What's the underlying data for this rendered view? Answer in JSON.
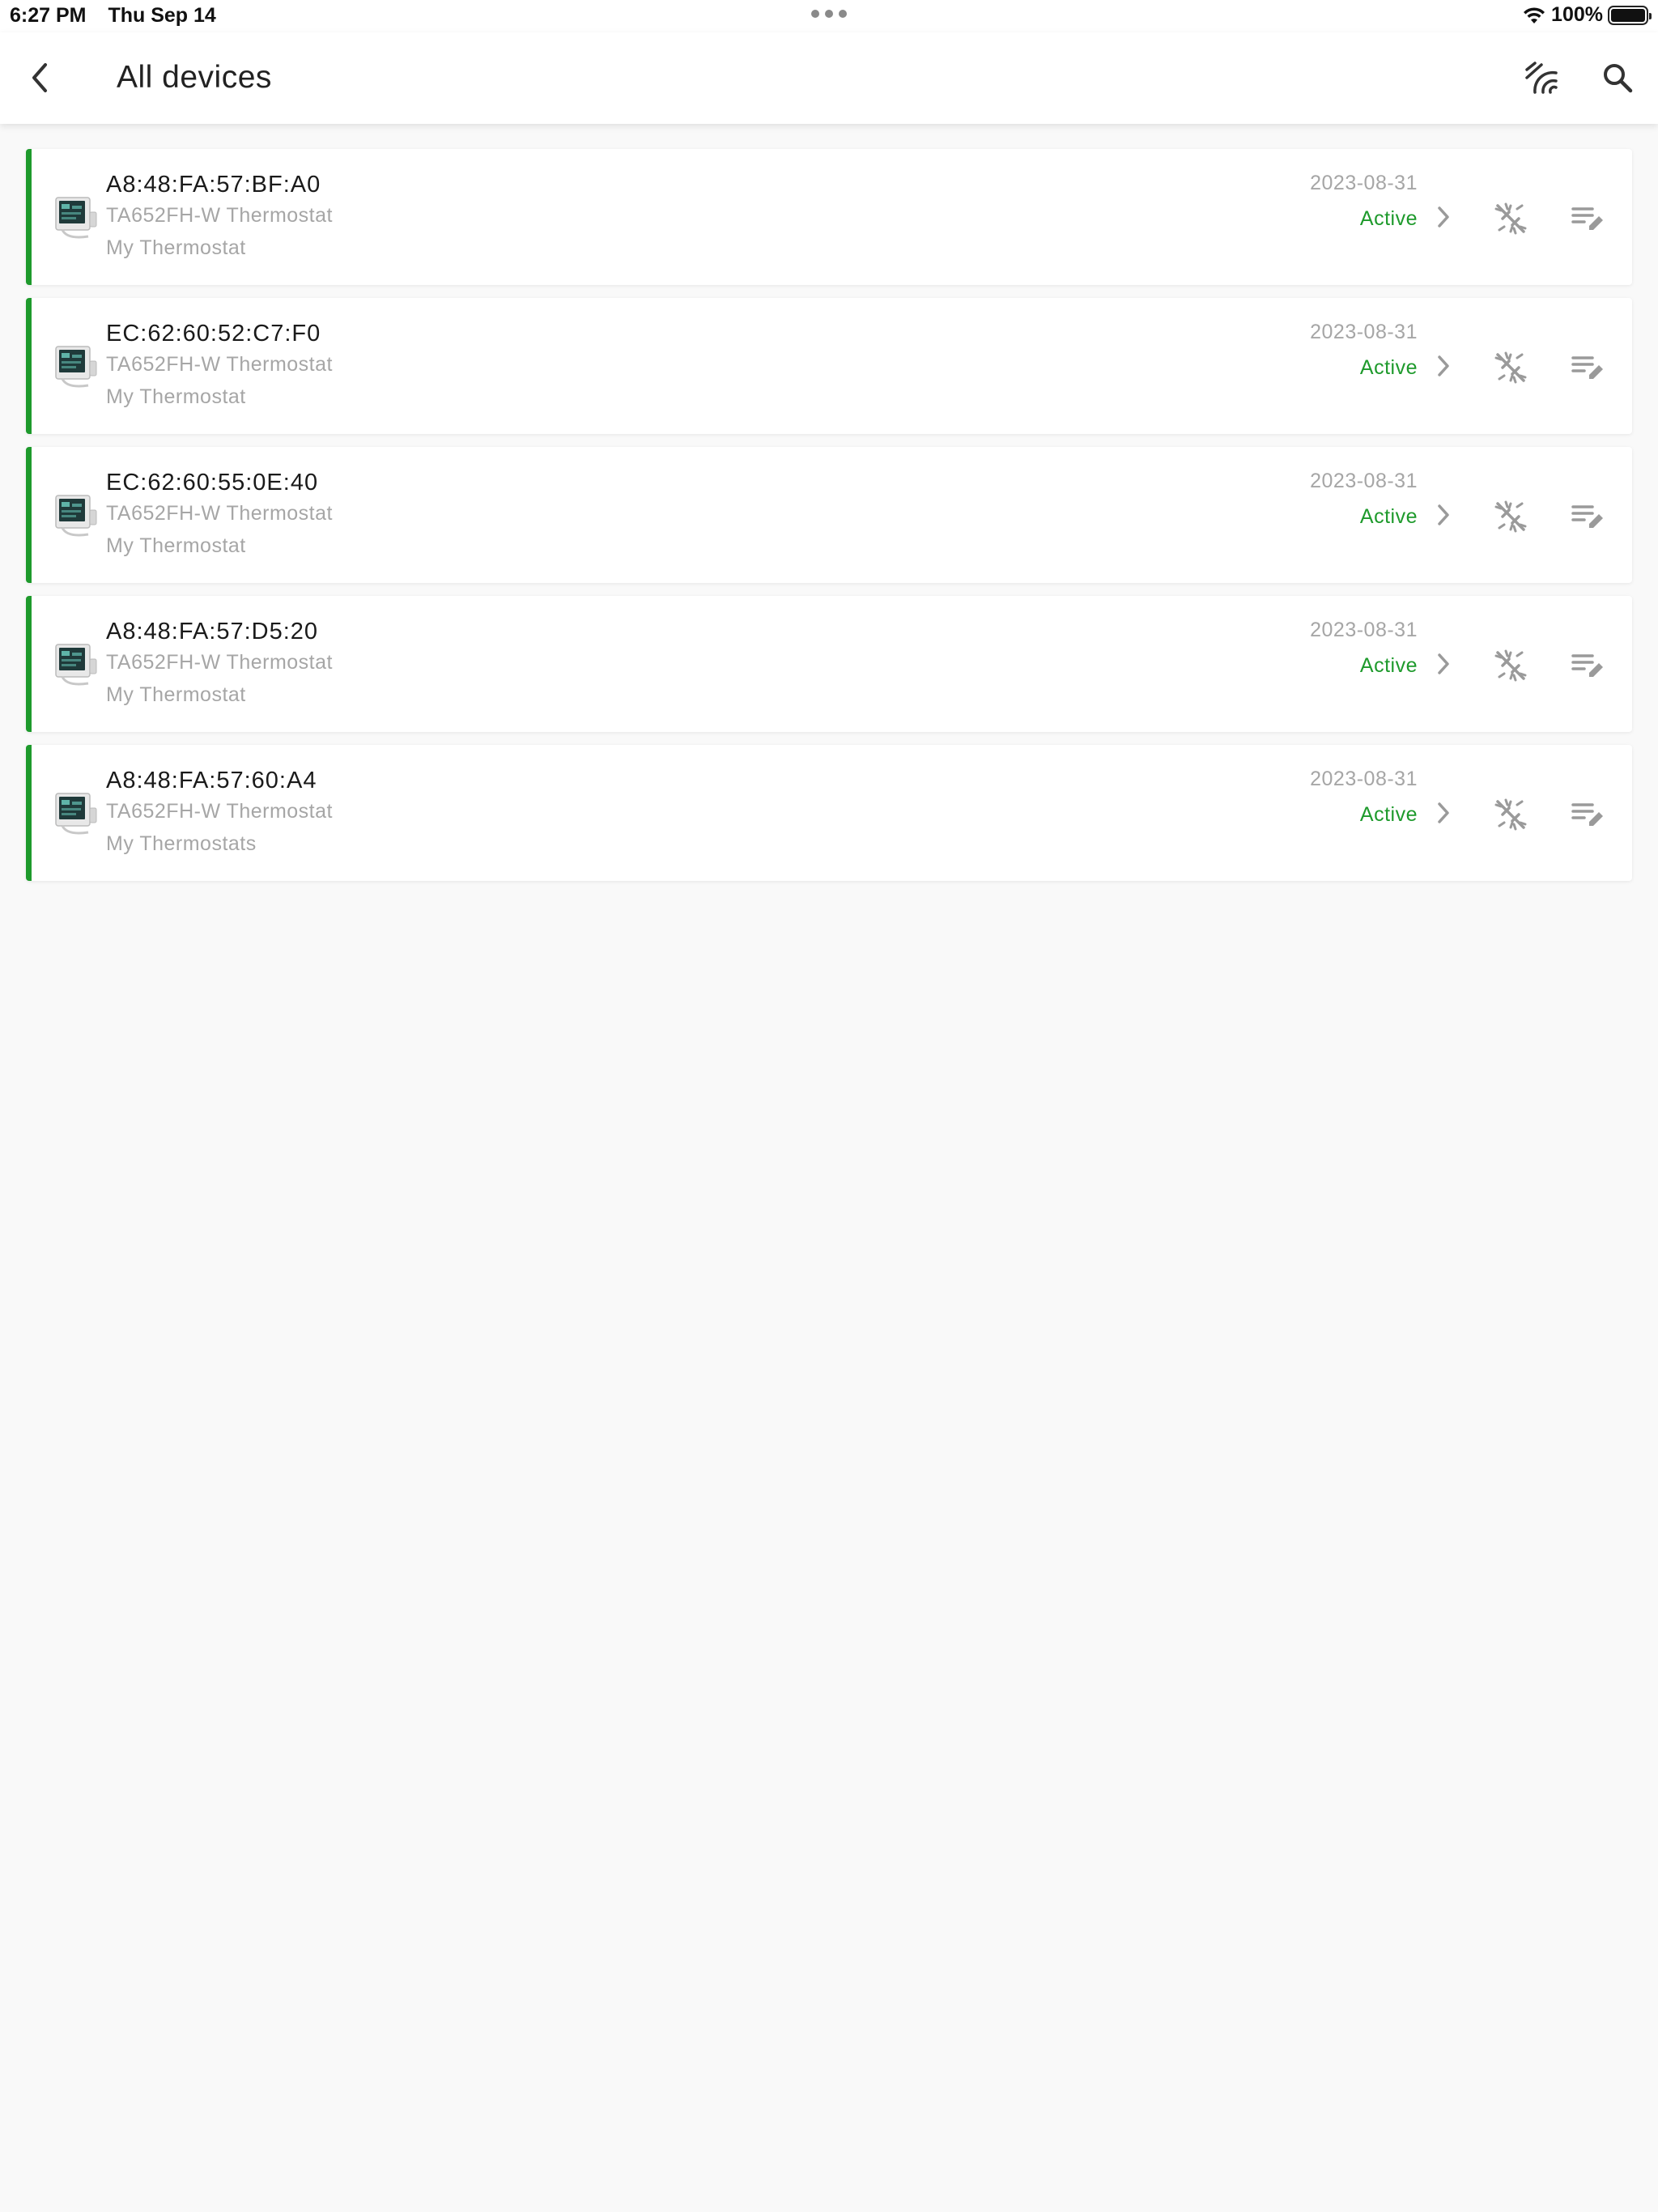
{
  "status_bar": {
    "time": "6:27 PM",
    "date": "Thu Sep 14",
    "battery": "100%",
    "battery_level": 1.0,
    "icons": [
      "wifi-icon",
      "battery-icon",
      "multitasking-dots-icon"
    ]
  },
  "header": {
    "title": "All devices",
    "icons": [
      "back-arrow-icon",
      "signal-scan-icon",
      "search-icon"
    ]
  },
  "colors": {
    "accent_green": "#1e9a2c",
    "muted_text": "#a6a6a6",
    "background": "#f9f9f9"
  },
  "devices": [
    {
      "mac": "A8:48:FA:57:BF:A0",
      "model": "TA652FH-W Thermostat",
      "name": "My Thermostat",
      "date": "2023-08-31",
      "status": "Active"
    },
    {
      "mac": "EC:62:60:52:C7:F0",
      "model": "TA652FH-W Thermostat",
      "name": "My Thermostat",
      "date": "2023-08-31",
      "status": "Active"
    },
    {
      "mac": "EC:62:60:55:0E:40",
      "model": "TA652FH-W Thermostat",
      "name": "My Thermostat",
      "date": "2023-08-31",
      "status": "Active"
    },
    {
      "mac": "A8:48:FA:57:D5:20",
      "model": "TA652FH-W Thermostat",
      "name": "My Thermostat",
      "date": "2023-08-31",
      "status": "Active"
    },
    {
      "mac": "A8:48:FA:57:60:A4",
      "model": "TA652FH-W Thermostat",
      "name": "My Thermostats",
      "date": "2023-08-31",
      "status": "Active"
    }
  ]
}
